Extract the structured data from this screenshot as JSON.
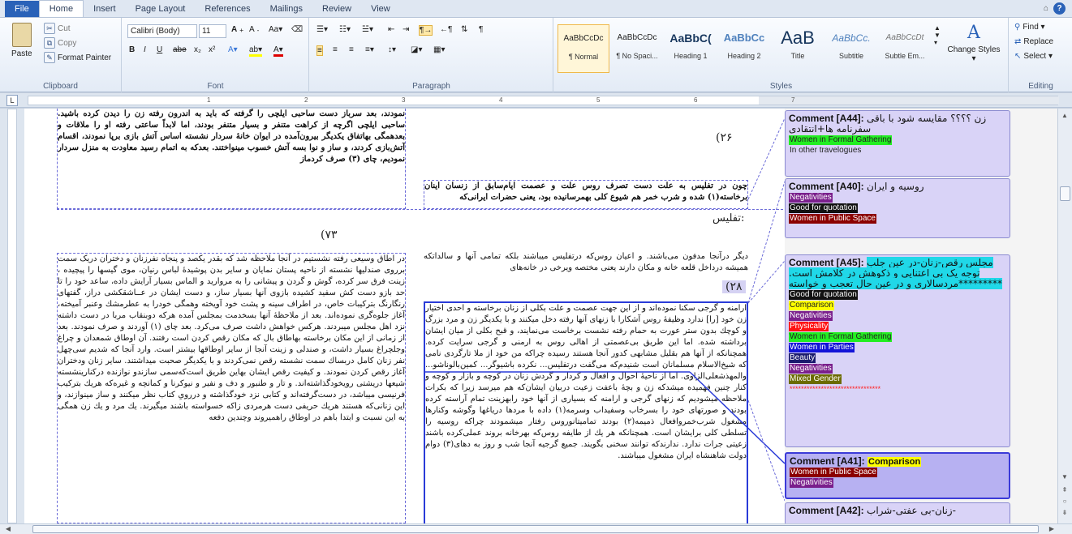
{
  "tabs": [
    "File",
    "Home",
    "Insert",
    "Page Layout",
    "References",
    "Mailings",
    "Review",
    "View"
  ],
  "clipboard": {
    "paste": "Paste",
    "cut": "Cut",
    "copy": "Copy",
    "format_painter": "Format Painter",
    "label": "Clipboard"
  },
  "font": {
    "name": "Calibri (Body)",
    "size": "11",
    "label": "Font",
    "bold": "B",
    "italic": "I",
    "underline": "U",
    "strike": "abe",
    "sub": "x₂",
    "sup": "x²"
  },
  "paragraph": {
    "label": "Paragraph"
  },
  "styles": {
    "label": "Styles",
    "items": [
      {
        "sample": "AaBbCcDc",
        "name": "¶ Normal"
      },
      {
        "sample": "AaBbCcDc",
        "name": "¶ No Spaci..."
      },
      {
        "sample": "AaBbC(",
        "name": "Heading 1"
      },
      {
        "sample": "AaBbCc",
        "name": "Heading 2"
      },
      {
        "sample": "AaB",
        "name": "Title"
      },
      {
        "sample": "AaBbCc.",
        "name": "Subtitle"
      },
      {
        "sample": "AaBbCcDt",
        "name": "Subtle Em..."
      }
    ],
    "change": "Change Styles ▾"
  },
  "editing": {
    "find": "Find ▾",
    "replace": "Replace",
    "select": "Select ▾",
    "label": "Editing"
  },
  "ruler_numbers": [
    "1",
    "2",
    "3",
    "4",
    "5",
    "6",
    "7"
  ],
  "page": {
    "num_26": "(۲۶",
    "num_73": "(۷۳",
    "num_28": "(۲۸",
    "heading_tiflis": "تفلیس:",
    "text_top_left": "نمودند، بعد سرباز دست ساحبی ایلچی را گرفته که باید به اندرون رفته زن را دیدن کرده باشید. ساحبی ایلچی اگرچه از کراهت متنفر و بسیار متنفر بودند، اما لابداً ساعتی رفته او را ملاقات و بعدهمگی بهاتفاق یکدیگر بیرون‌آمده در ایوان خانهٔ سردار نشسته اساس آتش بازی برپا نمودند، اقسام آتش‌بازی کردند، و ساز و نوا بسه آتش خسوب مینواختند. بعدکه به اتمام رسید معاودت به منزل سردار نمودیم، چای (۳) صرف کردماز",
    "text_top_right": "چون در تفلیس به علت دست تصرف روس علت و عصمت ایام‌سابق از زنسان اینان برخاسته(۱) شده و شرب خمر هم شیوع کلی بهمرسانیده بود، یعنی حضرات ایرانی‌که",
    "text_mid_right": "دیگر درآنجا مدفون می‌باشند. و اعیان روس‌که درتفلیس میباشند بلکه تمامی آنها و سالداتکه همیشه درداخل قلعه خانه و مکان دارند یعنی مختصه ویرخی در خانه‌های",
    "text_left_long": "در اطاق وسیعی رفته نشستیم در آنجا ملاحظه شد که بقدر یکصد و پنجاه نفرزنان و دختران دریک سمت برروی صندلیها نشسته از ناحیه پستان نمایان و سایر بدن پوشیدهٔ لباس رنیان، موی گیسها را پیچیده ، زینت فرق سر کرده، گوش و گردن و پیشانی را به مروارید و الماس بسیار آرایش داده، ساعد خود را تا حد بازو دست کش سفید کشیده بازوی آنها بسیار ساز، و دست ایشان در عــاشقکشی دراز، گفتهای رنگارنگ بترکیبات خاص، در اطراف سینه و پشت خود آویخته وهمگی خودرا به عطرمشك وعنبر آمیخته، آغاز جلوه‌گری نموده‌اند. بعد از ملاحظهٔ آنها بسخدمت بمجلس آمده هرکه دوبنقاب مربا در دست داشته نزد اهل مجلس میبردند. هرکس خواهش داشت صرف می‌کرد. بعد چای (۱) آوردند و صرف نمودند. بعد از زمانی از این مکان برخاسته بهاطاق بال که مکان رقص کردن است رفتند. آن اوطاق شمعدان و چراغ وجلچراغ بسیار داشت، و صندلی و زینت آنجا از سایر اوطاقها بیشتر است. وارد آنجا که شدیم سی‌چهل نفر زنان کامل دربساك سمت نشسته رقص نمی‌کردند و با یکدیگر صحبت میداشتند. سایر زنان ودختران آغاز رقص کردن نمودند. و کیفیت رقص ایشان بهاین طریق است‌که‌سمی سازندو نوازنده درکنارینشسته شیعها دریشتی رویخودگذاشته‌اند. و تار و طنبور و دف و نفیر و نیوکرنا و کمانچه و غیره‌که هریك بترکیب فرنیسی میباشد، در دست‌گرفته‌اند و کتابی نزد خودگذاشته و دررویِ کتاب نظر میکنند و ساز مینوازند، و این زنانی‌که هستند هریك حریفی دست هرمردی زاکه خسواسته باشند میگیرند. یك مرد و یك زن همگی به این نسبت و ابتدا باهم در اوطاق راهمیروند وچندین دفعه",
    "text_right_long": "ارامنه و گرجی سکنا نموده‌اند و از این جهت عصمت و علت بکلی از زنان برخاسته و احدی اختیار زن خود [را] ندارد وظیفهٔ روس آشکارا با زنهای آنها رفته دخل میکنند و با یکدیگر زن و مرد بزرگ و کوچك بدون ستر عورت به حمام رفته نشست برخاست می‌نمایند، و قبح بکلی از میان ایشان برداشته شده. اما این طریق بی‌عصمتی از اهالی روس به ارمنی و گرجی سرایت کرده. همچنانکه از آنها هم بقلیل مشابهی کدور آنجا هستند رسیده چراکه من خود از ملا تارگردی نامی که شیخ‌الاسلام مسلمانان است شنیدم‌که می‌گفت درتفلیس... نکرده باشیو‌گر... کمین‌بالوناشو... والمهذشعلی‌الزاوی. اما از ناحیهٔ احوال و افعال و کردار و گردش زنان در کوچه و بازار و کوچه و کنار چنین فهمیده میشدکه زن و بچهٔ باعفت زعیت دربیان ایشان‌که هم میرسد زیرا که بکرات ملاحظه میشودیم که زنهای گرجی و ارامنه که بسیاری از آنها خود رابهزینت تمام آراسته کرده بودند و صورتهای خود را بسرخاب وسفیداب وسرمه(۱) داده با مردها دریاغها وگوشه وکنارها مشغول شرب‌خمروافعال ذمیمه(۲) بودند تمامیتانوروس رفتار میشمودند چراکه روسیه را تسلطی کلی برایشان است. همچنانکه هر یك از طایفه روس‌که بهرخانه بروند عملی‌کرده باشند زعیتی جرات ندارد. ندارندکه توانند سخنی بگویند. جمیع گرجیه آنجا شب و روز به دهای(۳) دوام دولت شاهنشاه ایران مشغول میباشند."
  },
  "comments": [
    {
      "id": "Comment [A44]:",
      "text": "زن ؟؟؟؟ مقایسه شود با باقی سفرنامه ها+انتقادی",
      "tags": [
        {
          "t": "Women in Formal Gathering",
          "c": "#22ee22",
          "f": "#000"
        },
        {
          "t": "In other travelogues",
          "c": "transparent",
          "f": "#000"
        }
      ]
    },
    {
      "id": "Comment [A40]:",
      "text": "روسیه و ایران",
      "tags": [
        {
          "t": "Negativities",
          "c": "#7a1f8c",
          "f": "#fff"
        },
        {
          "t": "Good for quotation",
          "c": "#111",
          "f": "#fff"
        },
        {
          "t": "Women in Public Space",
          "c": "#8b0000",
          "f": "#fff"
        }
      ]
    },
    {
      "id": "Comment [A45]:",
      "text": "مجلس رقص-زنان-در عین جلب توجه یک بی اعتنایی و ذکوهش در کلامش است. مردسالاری و در عین حال تعجب و خواسته*********",
      "tags": [
        {
          "t": "Good for quotation",
          "c": "#111",
          "f": "#fff"
        },
        {
          "t": "Comparison",
          "c": "#ffff00",
          "f": "#000"
        },
        {
          "t": "Negativities",
          "c": "#7a1f8c",
          "f": "#fff"
        },
        {
          "t": "Physicality",
          "c": "#ff1111",
          "f": "#fff"
        },
        {
          "t": "Women in Formal Gathering",
          "c": "#22ee22",
          "f": "#000"
        },
        {
          "t": "Women in Parties",
          "c": "#1414d8",
          "f": "#fff"
        },
        {
          "t": "Beauty",
          "c": "#1a1a6e",
          "f": "#fff"
        },
        {
          "t": "Negativities",
          "c": "#7a1f8c",
          "f": "#fff"
        },
        {
          "t": "Mixed Gender",
          "c": "#6b6b00",
          "f": "#fff"
        },
        {
          "t": "********************************",
          "c": "transparent",
          "f": "#ff2222"
        }
      ]
    },
    {
      "id": "Comment [A41]:",
      "text": "",
      "inline_tag": {
        "t": "Comparison",
        "c": "#ffff00",
        "f": "#000"
      },
      "tags": [
        {
          "t": "Women in Public Space",
          "c": "#8b0000",
          "f": "#fff"
        },
        {
          "t": "Negativities",
          "c": "#7a1f8c",
          "f": "#fff"
        }
      ]
    },
    {
      "id": "Comment [A42]:",
      "text": "زنان-بی عفتی-شراب-",
      "tags": []
    }
  ]
}
